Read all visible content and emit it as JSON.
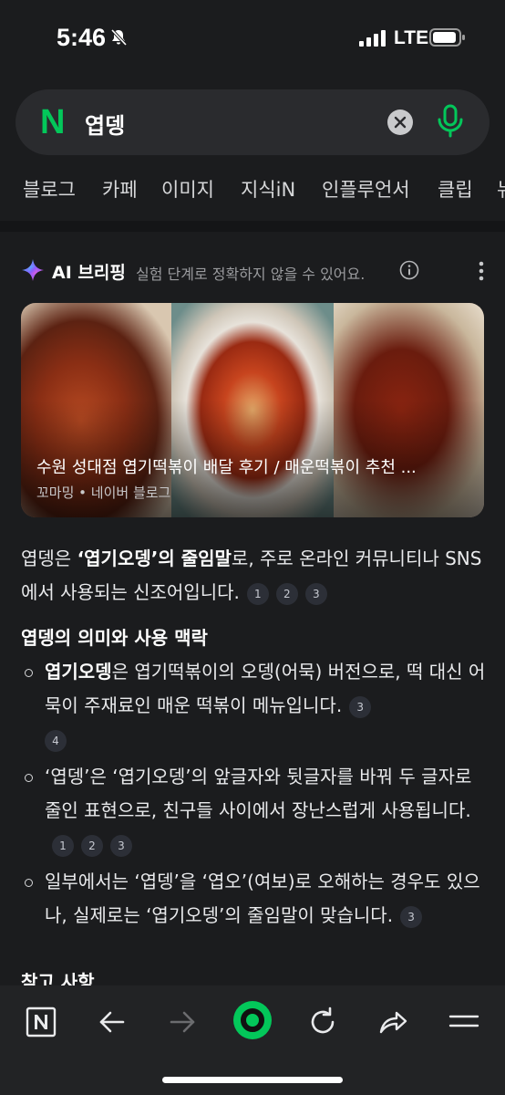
{
  "status_bar": {
    "time": "5:46",
    "network": "LTE"
  },
  "search": {
    "logo": "N",
    "query": "엽뎅"
  },
  "tabs": [
    "블로그",
    "카페",
    "이미지",
    "지식iN",
    "인플루언서",
    "클립",
    "뉴"
  ],
  "ai_briefing": {
    "title": "AI 브리핑",
    "subtitle": "실험 단계로 정확하지 않을 수 있어요.",
    "card": {
      "title": "수원 성대점 엽기떡볶이 배달 후기 / 매운떡볶이 추천 ...",
      "source": "꼬마밍 • 네이버 블로그"
    },
    "intro": {
      "pre": "엽뎅은 ",
      "bold": "‘엽기오뎅’의 줄임말",
      "post": "로, 주로 온라인 커뮤니티나 SNS에서 사용되는 신조어입니다.",
      "cites": [
        "1",
        "2",
        "3"
      ]
    },
    "section1_heading": "엽뎅의 의미와 사용 맥락",
    "bullets": [
      {
        "bold": "엽기오뎅",
        "text": "은 엽기떡볶이의 오뎅(어묵) 버전으로, 떡 대신 어묵이 주재료인 매운 떡볶이 메뉴입니다.",
        "cites": [
          "3",
          "4"
        ]
      },
      {
        "bold": "",
        "text": "‘엽뎅’은 ‘엽기오뎅’의 앞글자와 뒷글자를 바꿔 두 글자로 줄인 표현으로, 친구들 사이에서 장난스럽게 사용됩니다.",
        "cites": [
          "1",
          "2",
          "3"
        ]
      },
      {
        "bold": "",
        "text": "일부에서는 ‘엽뎅’을 ‘엽오’(여보)로 오해하는 경우도 있으나, 실제로는 ‘엽기오뎅’의 줄임말이 맞습니다.",
        "cites": [
          "3"
        ]
      }
    ],
    "section2_heading": "참고 사항"
  },
  "colors": {
    "accent": "#03c75a",
    "background": "#1b1c1e",
    "nav": "#222325"
  },
  "bottom_nav": {
    "items": [
      "naver-home-icon",
      "back-arrow-icon",
      "forward-arrow-icon",
      "green-dot-icon",
      "refresh-icon",
      "share-icon",
      "menu-icon"
    ]
  }
}
